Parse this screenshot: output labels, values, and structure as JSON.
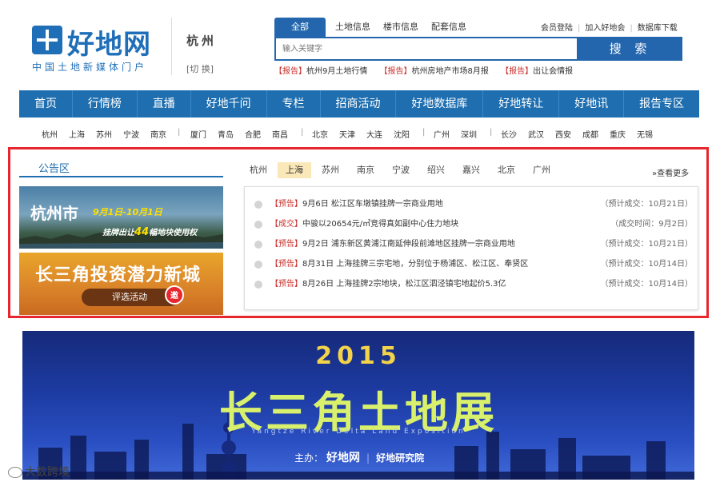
{
  "brand": {
    "name": "好地网",
    "tagline": "中国土地新媒体门户",
    "city": "杭州",
    "switch_label": "[切 换]"
  },
  "search": {
    "tabs": [
      "全部",
      "土地信息",
      "楼市信息",
      "配套信息"
    ],
    "active_tab": "全部",
    "placeholder": "输入关键字",
    "button_label": "搜 索"
  },
  "header_links": [
    "会员登陆",
    "加入好地会",
    "数据库下载"
  ],
  "report_links": [
    {
      "tag": "【报告】",
      "text": "杭州9月土地行情"
    },
    {
      "tag": "【报告】",
      "text": "杭州房地产市场8月报"
    },
    {
      "tag": "【报告】",
      "text": "出让会情报"
    }
  ],
  "main_nav": [
    "首页",
    "行情榜",
    "直播",
    "好地千问",
    "专栏",
    "招商活动",
    "好地数据库",
    "好地转让",
    "好地讯",
    "报告专区"
  ],
  "city_bar": [
    "杭州",
    "上海",
    "苏州",
    "宁波",
    "南京",
    "厦门",
    "青岛",
    "合肥",
    "南昌",
    "北京",
    "天津",
    "大连",
    "沈阳",
    "广州",
    "深圳",
    "长沙",
    "武汉",
    "西安",
    "成都",
    "重庆",
    "无锡"
  ],
  "notice": {
    "title": "公告区",
    "city_tabs": [
      "杭州",
      "上海",
      "苏州",
      "南京",
      "宁波",
      "绍兴",
      "嘉兴",
      "北京",
      "广州"
    ],
    "active_city": "上海",
    "more_label": "»查看更多",
    "banner1": {
      "title": "杭州市",
      "date": "9月1日-10月1日",
      "sub_prefix": "挂牌出让",
      "sub_count": "44",
      "sub_suffix": "幅地块使用权"
    },
    "banner2": {
      "title": "长三角投资潜力新城",
      "button": "评选活动",
      "badge": "邀"
    },
    "news": [
      {
        "tag": "【预告】",
        "text": "9月6日 松江区车墩镇挂牌一宗商业用地",
        "time": "（预计成交：10月21日）"
      },
      {
        "tag": "【成交】",
        "text": "中骏以20654元/㎡竞得真如副中心住力地块",
        "time": "（成交时间：9月2日）"
      },
      {
        "tag": "【预告】",
        "text": "9月2日 浦东新区黄浦江南延伸段前滩地区挂牌一宗商业用地",
        "time": "（预计成交：10月21日）"
      },
      {
        "tag": "【预告】",
        "text": "8月31日 上海挂牌三宗宅地，分别位于杨浦区、松江区、奉贤区",
        "time": "（预计成交：10月14日）"
      },
      {
        "tag": "【预告】",
        "text": "8月26日 上海挂牌2宗地块，松江区泗泾镇宅地起价5.3亿",
        "time": "（预计成交：10月14日）"
      }
    ]
  },
  "expo_banner": {
    "year": "2015",
    "title": "长三角土地展",
    "english": "Yangtze River Delta Land Exposition",
    "host_label": "主办：",
    "host_logo": "好地网",
    "host_institute": "好地研究院"
  },
  "watermark": "大数跨境",
  "colors": {
    "brand_blue": "#1f6fb0",
    "highlight_red": "#e8262d",
    "tag_red": "#c9302c",
    "active_city_bg": "#fbe8b9"
  }
}
